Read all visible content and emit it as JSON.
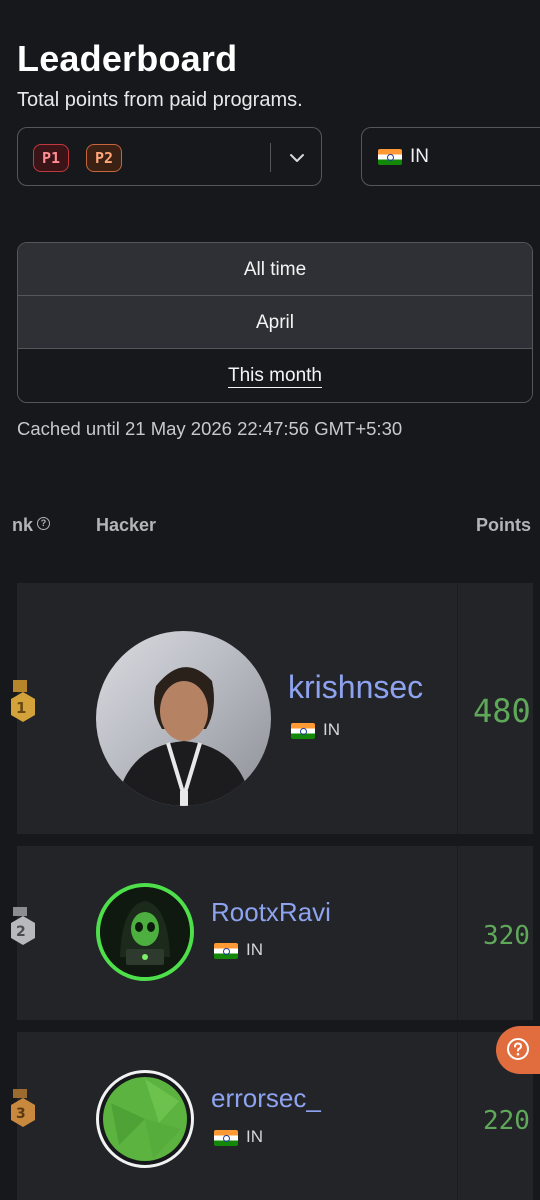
{
  "header": {
    "title": "Leaderboard",
    "subtitle": "Total points from paid programs."
  },
  "filters": {
    "severities": [
      "P1",
      "P2"
    ],
    "country": "IN"
  },
  "periods": [
    {
      "label": "All time",
      "active": false
    },
    {
      "label": "April",
      "active": false
    },
    {
      "label": "This month",
      "active": true
    }
  ],
  "cached_text": "Cached until 21 May 2026 22:47:56 GMT+5:30",
  "table": {
    "columns": {
      "rank": "nk",
      "hacker": "Hacker",
      "points": "Points"
    },
    "rows": [
      {
        "rank": "1",
        "username": "krishnsec",
        "country": "IN",
        "points": "480",
        "medal_color": "#d4a23a"
      },
      {
        "rank": "2",
        "username": "RootxRavi",
        "country": "IN",
        "points": "320",
        "medal_color": "#b8b9bd"
      },
      {
        "rank": "3",
        "username": "errorsec_",
        "country": "IN",
        "points": "220",
        "medal_color": "#c8893e"
      }
    ]
  },
  "colors": {
    "background": "#17181c",
    "row_background": "#232428",
    "username": "#8ea3ef",
    "points": "#5fa85a",
    "help_button": "#e16c3e"
  }
}
